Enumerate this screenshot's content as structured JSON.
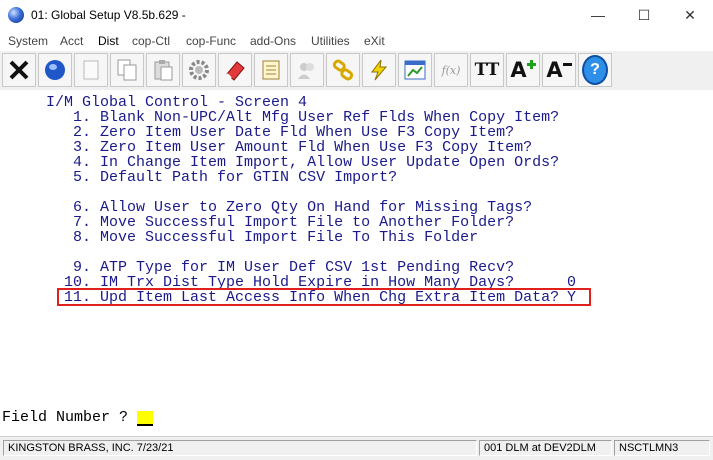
{
  "window": {
    "title": "01: Global Setup V8.5b.629 -",
    "minimize_glyph": "—",
    "maximize_glyph": "☐",
    "close_glyph": "✕"
  },
  "menu": [
    "System",
    "Acct",
    "Dist",
    "cop-Ctl",
    "cop-Func",
    "add-Ons",
    "Utilities",
    "eXit"
  ],
  "toolbar": {
    "icons": [
      "close-x-icon",
      "globe-icon",
      "blank-page-icon",
      "copy-icon",
      "paste-icon",
      "settings-gear-icon",
      "eraser-icon",
      "notepad-icon",
      "users-icon",
      "chain-link-icon",
      "lightning-icon",
      "chart-window-icon",
      "function-icon",
      "font-tt-icon",
      "font-increase-icon",
      "font-decrease-icon",
      "help-icon"
    ],
    "font_label": "TT",
    "font_large_label": "A",
    "help_label": "?",
    "function_label": "f(x)"
  },
  "screen": {
    "header": "I/M Global Control - Screen 4",
    "items": [
      {
        "num": " 1.",
        "text": "Blank Non-UPC/Alt Mfg User Ref Flds When Copy Item?",
        "value": ""
      },
      {
        "num": " 2.",
        "text": "Zero Item User Date Fld When Use F3 Copy Item?",
        "value": ""
      },
      {
        "num": " 3.",
        "text": "Zero Item User Amount Fld When Use F3 Copy Item?",
        "value": ""
      },
      {
        "num": " 4.",
        "text": "In Change Item Import, Allow User Update Open Ords?",
        "value": ""
      },
      {
        "num": " 5.",
        "text": "Default Path for GTIN CSV Import?",
        "value": ""
      },
      {
        "num": " 6.",
        "text": "Allow User to Zero Qty On Hand for Missing Tags?",
        "value": ""
      },
      {
        "num": " 7.",
        "text": "Move Successful Import File to Another Folder?",
        "value": ""
      },
      {
        "num": " 8.",
        "text": "Move Successful Import File To This Folder",
        "value": ""
      },
      {
        "num": " 9.",
        "text": "ATP Type for IM User Def CSV 1st Pending Recv?",
        "value": ""
      },
      {
        "num": "10.",
        "text": "IM Trx Dist Type Hold Expire in How Many Days?",
        "value": "0"
      },
      {
        "num": "11.",
        "text": "Upd Item Last Access Info When Chg Extra Item Data?",
        "value": "Y"
      }
    ],
    "prompt": "Field Number ?"
  },
  "status": {
    "company": "KINGSTON BRASS, INC. 7/23/21",
    "session": "001 DLM at DEV2DLM",
    "program": "NSCTLMN3"
  },
  "colors": {
    "terminal_text": "#1a1a8a",
    "highlight_border": "#e0201c",
    "cursor": "#ffff00"
  }
}
